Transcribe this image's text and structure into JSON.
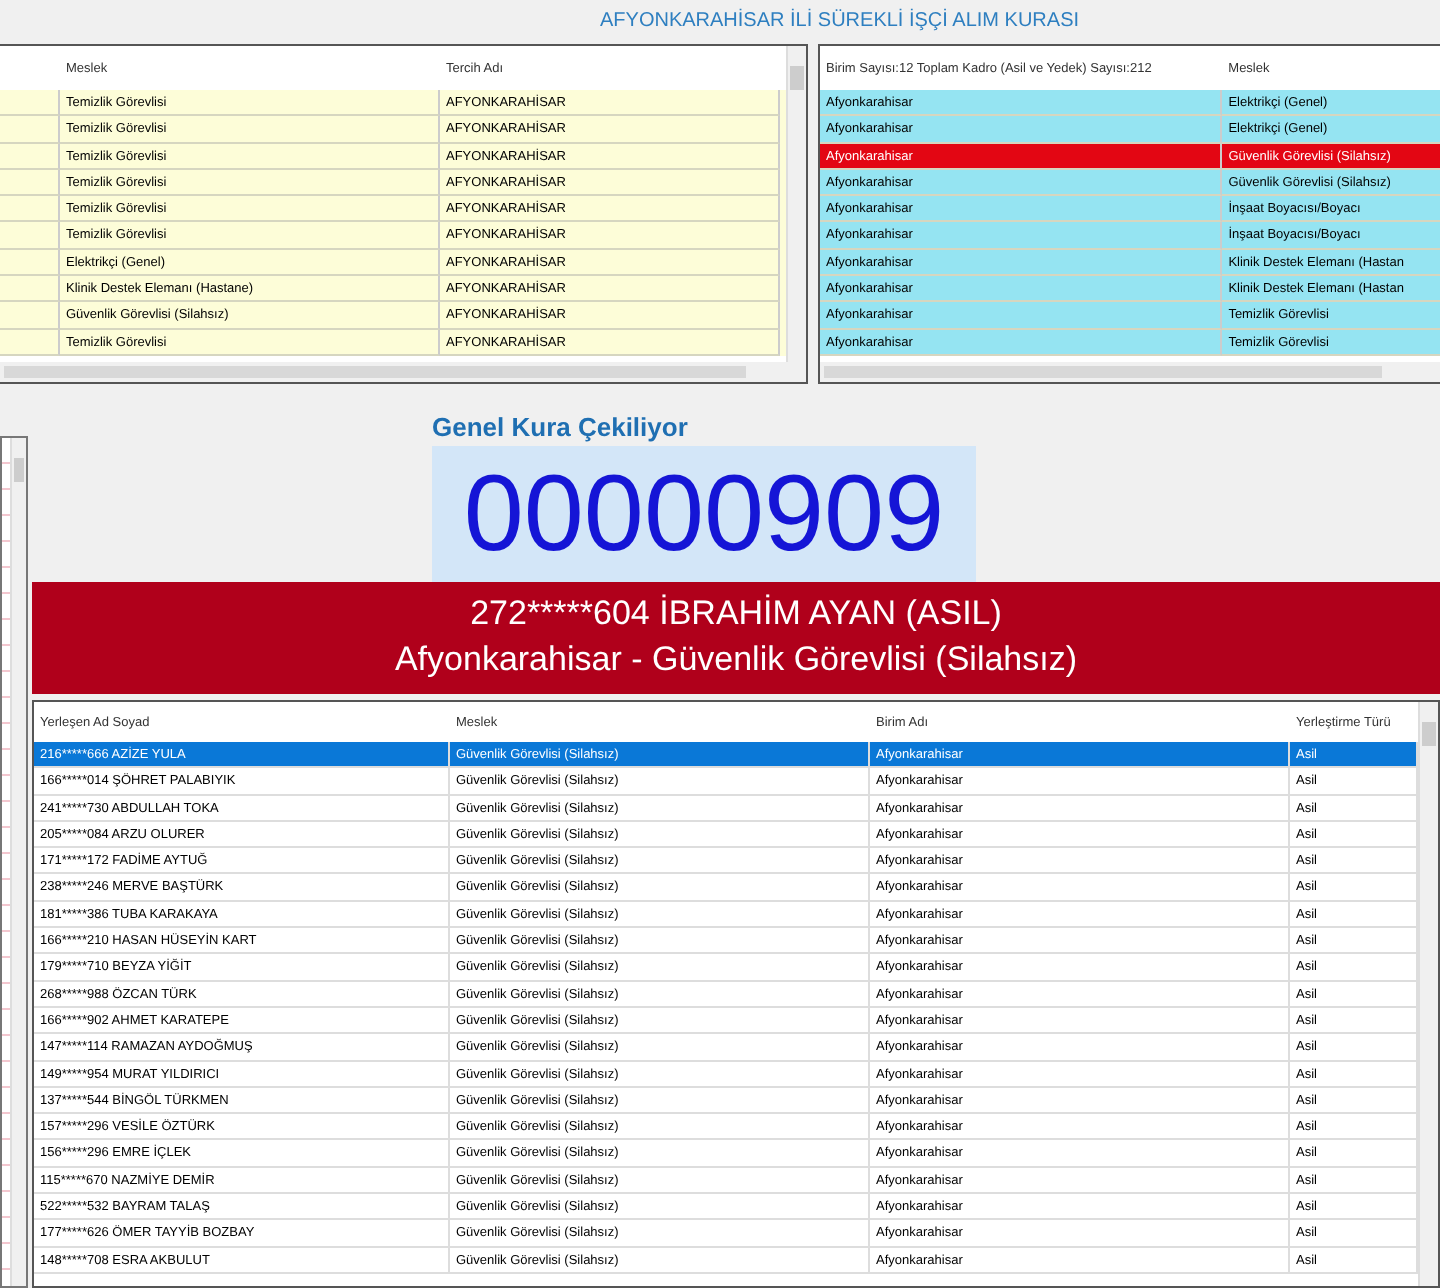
{
  "title": "AFYONKARAHİSAR İLİ SÜREKLİ İŞÇİ ALIM KURASI",
  "left_table": {
    "columns": [
      "Meslek",
      "Tercih Adı"
    ],
    "rows": [
      {
        "cells": [
          "Temizlik Görevlisi",
          "AFYONKARAHİSAR"
        ]
      },
      {
        "cells": [
          "Temizlik Görevlisi",
          "AFYONKARAHİSAR"
        ]
      },
      {
        "cells": [
          "Temizlik Görevlisi",
          "AFYONKARAHİSAR"
        ]
      },
      {
        "cells": [
          "Temizlik Görevlisi",
          "AFYONKARAHİSAR"
        ]
      },
      {
        "cells": [
          "Temizlik Görevlisi",
          "AFYONKARAHİSAR"
        ]
      },
      {
        "cells": [
          "Temizlik Görevlisi",
          "AFYONKARAHİSAR"
        ]
      },
      {
        "cells": [
          "Elektrikçi (Genel)",
          "AFYONKARAHİSAR"
        ]
      },
      {
        "cells": [
          "Klinik Destek Elemanı (Hastane)",
          "AFYONKARAHİSAR"
        ]
      },
      {
        "cells": [
          "Güvenlik Görevlisi (Silahsız)",
          "AFYONKARAHİSAR"
        ]
      },
      {
        "cells": [
          "Temizlik Görevlisi",
          "AFYONKARAHİSAR"
        ]
      }
    ]
  },
  "right_table": {
    "columns": [
      "Birim Sayısı:12 Toplam Kadro (Asil ve Yedek) Sayısı:212",
      "Meslek"
    ],
    "rows": [
      {
        "cells": [
          "Afyonkarahisar",
          "Elektrikçi (Genel)"
        ],
        "selected": false
      },
      {
        "cells": [
          "Afyonkarahisar",
          "Elektrikçi (Genel)"
        ],
        "selected": false
      },
      {
        "cells": [
          "Afyonkarahisar",
          "Güvenlik Görevlisi (Silahsız)"
        ],
        "selected": true
      },
      {
        "cells": [
          "Afyonkarahisar",
          "Güvenlik Görevlisi (Silahsız)"
        ],
        "selected": false
      },
      {
        "cells": [
          "Afyonkarahisar",
          "İnşaat Boyacısı/Boyacı"
        ],
        "selected": false
      },
      {
        "cells": [
          "Afyonkarahisar",
          "İnşaat Boyacısı/Boyacı"
        ],
        "selected": false
      },
      {
        "cells": [
          "Afyonkarahisar",
          "Klinik Destek Elemanı (Hastan"
        ],
        "selected": false
      },
      {
        "cells": [
          "Afyonkarahisar",
          "Klinik Destek Elemanı (Hastan"
        ],
        "selected": false
      },
      {
        "cells": [
          "Afyonkarahisar",
          "Temizlik Görevlisi"
        ],
        "selected": false
      },
      {
        "cells": [
          "Afyonkarahisar",
          "Temizlik Görevlisi"
        ],
        "selected": false
      }
    ]
  },
  "draw": {
    "heading": "Genel Kura Çekiliyor",
    "number": "00000909",
    "winner_line": "272*****604 İBRAHİM AYAN (ASIL)",
    "winner_place": "Afyonkarahisar - Güvenlik Görevlisi (Silahsız)"
  },
  "results_table": {
    "columns": [
      "Yerleşen Ad Soyad",
      "Meslek",
      "Birim Adı",
      "Yerleştirme Türü"
    ],
    "rows": [
      {
        "cells": [
          "216*****666 AZİZE YULA",
          "Güvenlik Görevlisi (Silahsız)",
          "Afyonkarahisar",
          "Asil"
        ],
        "selected": true
      },
      {
        "cells": [
          "166*****014 ŞÖHRET PALABIYIK",
          "Güvenlik Görevlisi (Silahsız)",
          "Afyonkarahisar",
          "Asil"
        ],
        "selected": false
      },
      {
        "cells": [
          "241*****730 ABDULLAH TOKA",
          "Güvenlik Görevlisi (Silahsız)",
          "Afyonkarahisar",
          "Asil"
        ],
        "selected": false
      },
      {
        "cells": [
          "205*****084 ARZU OLURER",
          "Güvenlik Görevlisi (Silahsız)",
          "Afyonkarahisar",
          "Asil"
        ],
        "selected": false
      },
      {
        "cells": [
          "171*****172 FADİME AYTUĞ",
          "Güvenlik Görevlisi (Silahsız)",
          "Afyonkarahisar",
          "Asil"
        ],
        "selected": false
      },
      {
        "cells": [
          "238*****246 MERVE BAŞTÜRK",
          "Güvenlik Görevlisi (Silahsız)",
          "Afyonkarahisar",
          "Asil"
        ],
        "selected": false
      },
      {
        "cells": [
          "181*****386 TUBA KARAKAYA",
          "Güvenlik Görevlisi (Silahsız)",
          "Afyonkarahisar",
          "Asil"
        ],
        "selected": false
      },
      {
        "cells": [
          "166*****210 HASAN HÜSEYİN KART",
          "Güvenlik Görevlisi (Silahsız)",
          "Afyonkarahisar",
          "Asil"
        ],
        "selected": false
      },
      {
        "cells": [
          "179*****710 BEYZA YİĞİT",
          "Güvenlik Görevlisi (Silahsız)",
          "Afyonkarahisar",
          "Asil"
        ],
        "selected": false
      },
      {
        "cells": [
          "268*****988 ÖZCAN TÜRK",
          "Güvenlik Görevlisi (Silahsız)",
          "Afyonkarahisar",
          "Asil"
        ],
        "selected": false
      },
      {
        "cells": [
          "166*****902 AHMET KARATEPE",
          "Güvenlik Görevlisi (Silahsız)",
          "Afyonkarahisar",
          "Asil"
        ],
        "selected": false
      },
      {
        "cells": [
          "147*****114 RAMAZAN AYDOĞMUŞ",
          "Güvenlik Görevlisi (Silahsız)",
          "Afyonkarahisar",
          "Asil"
        ],
        "selected": false
      },
      {
        "cells": [
          "149*****954 MURAT YILDIRICI",
          "Güvenlik Görevlisi (Silahsız)",
          "Afyonkarahisar",
          "Asil"
        ],
        "selected": false
      },
      {
        "cells": [
          "137*****544 BİNGÖL TÜRKMEN",
          "Güvenlik Görevlisi (Silahsız)",
          "Afyonkarahisar",
          "Asil"
        ],
        "selected": false
      },
      {
        "cells": [
          "157*****296 VESİLE ÖZTÜRK",
          "Güvenlik Görevlisi (Silahsız)",
          "Afyonkarahisar",
          "Asil"
        ],
        "selected": false
      },
      {
        "cells": [
          "156*****296 EMRE İÇLEK",
          "Güvenlik Görevlisi (Silahsız)",
          "Afyonkarahisar",
          "Asil"
        ],
        "selected": false
      },
      {
        "cells": [
          "115*****670 NAZMİYE DEMİR",
          "Güvenlik Görevlisi (Silahsız)",
          "Afyonkarahisar",
          "Asil"
        ],
        "selected": false
      },
      {
        "cells": [
          "522*****532 BAYRAM TALAŞ",
          "Güvenlik Görevlisi (Silahsız)",
          "Afyonkarahisar",
          "Asil"
        ],
        "selected": false
      },
      {
        "cells": [
          "177*****626 ÖMER TAYYİB BOZBAY",
          "Güvenlik Görevlisi (Silahsız)",
          "Afyonkarahisar",
          "Asil"
        ],
        "selected": false
      },
      {
        "cells": [
          "148*****708 ESRA AKBULUT",
          "Güvenlik Görevlisi (Silahsız)",
          "Afyonkarahisar",
          "Asil"
        ],
        "selected": false
      }
    ]
  }
}
